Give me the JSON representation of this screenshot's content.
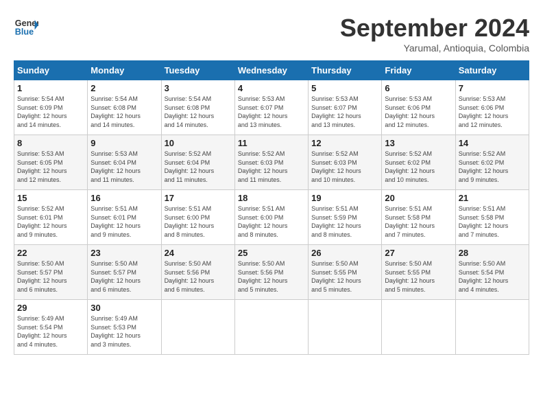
{
  "header": {
    "logo_line1": "General",
    "logo_line2": "Blue",
    "month": "September 2024",
    "location": "Yarumal, Antioquia, Colombia"
  },
  "columns": [
    "Sunday",
    "Monday",
    "Tuesday",
    "Wednesday",
    "Thursday",
    "Friday",
    "Saturday"
  ],
  "weeks": [
    [
      {
        "day": "1",
        "info": "Sunrise: 5:54 AM\nSunset: 6:09 PM\nDaylight: 12 hours\nand 14 minutes."
      },
      {
        "day": "2",
        "info": "Sunrise: 5:54 AM\nSunset: 6:08 PM\nDaylight: 12 hours\nand 14 minutes."
      },
      {
        "day": "3",
        "info": "Sunrise: 5:54 AM\nSunset: 6:08 PM\nDaylight: 12 hours\nand 14 minutes."
      },
      {
        "day": "4",
        "info": "Sunrise: 5:53 AM\nSunset: 6:07 PM\nDaylight: 12 hours\nand 13 minutes."
      },
      {
        "day": "5",
        "info": "Sunrise: 5:53 AM\nSunset: 6:07 PM\nDaylight: 12 hours\nand 13 minutes."
      },
      {
        "day": "6",
        "info": "Sunrise: 5:53 AM\nSunset: 6:06 PM\nDaylight: 12 hours\nand 12 minutes."
      },
      {
        "day": "7",
        "info": "Sunrise: 5:53 AM\nSunset: 6:06 PM\nDaylight: 12 hours\nand 12 minutes."
      }
    ],
    [
      {
        "day": "8",
        "info": "Sunrise: 5:53 AM\nSunset: 6:05 PM\nDaylight: 12 hours\nand 12 minutes."
      },
      {
        "day": "9",
        "info": "Sunrise: 5:53 AM\nSunset: 6:04 PM\nDaylight: 12 hours\nand 11 minutes."
      },
      {
        "day": "10",
        "info": "Sunrise: 5:52 AM\nSunset: 6:04 PM\nDaylight: 12 hours\nand 11 minutes."
      },
      {
        "day": "11",
        "info": "Sunrise: 5:52 AM\nSunset: 6:03 PM\nDaylight: 12 hours\nand 11 minutes."
      },
      {
        "day": "12",
        "info": "Sunrise: 5:52 AM\nSunset: 6:03 PM\nDaylight: 12 hours\nand 10 minutes."
      },
      {
        "day": "13",
        "info": "Sunrise: 5:52 AM\nSunset: 6:02 PM\nDaylight: 12 hours\nand 10 minutes."
      },
      {
        "day": "14",
        "info": "Sunrise: 5:52 AM\nSunset: 6:02 PM\nDaylight: 12 hours\nand 9 minutes."
      }
    ],
    [
      {
        "day": "15",
        "info": "Sunrise: 5:52 AM\nSunset: 6:01 PM\nDaylight: 12 hours\nand 9 minutes."
      },
      {
        "day": "16",
        "info": "Sunrise: 5:51 AM\nSunset: 6:01 PM\nDaylight: 12 hours\nand 9 minutes."
      },
      {
        "day": "17",
        "info": "Sunrise: 5:51 AM\nSunset: 6:00 PM\nDaylight: 12 hours\nand 8 minutes."
      },
      {
        "day": "18",
        "info": "Sunrise: 5:51 AM\nSunset: 6:00 PM\nDaylight: 12 hours\nand 8 minutes."
      },
      {
        "day": "19",
        "info": "Sunrise: 5:51 AM\nSunset: 5:59 PM\nDaylight: 12 hours\nand 8 minutes."
      },
      {
        "day": "20",
        "info": "Sunrise: 5:51 AM\nSunset: 5:58 PM\nDaylight: 12 hours\nand 7 minutes."
      },
      {
        "day": "21",
        "info": "Sunrise: 5:51 AM\nSunset: 5:58 PM\nDaylight: 12 hours\nand 7 minutes."
      }
    ],
    [
      {
        "day": "22",
        "info": "Sunrise: 5:50 AM\nSunset: 5:57 PM\nDaylight: 12 hours\nand 6 minutes."
      },
      {
        "day": "23",
        "info": "Sunrise: 5:50 AM\nSunset: 5:57 PM\nDaylight: 12 hours\nand 6 minutes."
      },
      {
        "day": "24",
        "info": "Sunrise: 5:50 AM\nSunset: 5:56 PM\nDaylight: 12 hours\nand 6 minutes."
      },
      {
        "day": "25",
        "info": "Sunrise: 5:50 AM\nSunset: 5:56 PM\nDaylight: 12 hours\nand 5 minutes."
      },
      {
        "day": "26",
        "info": "Sunrise: 5:50 AM\nSunset: 5:55 PM\nDaylight: 12 hours\nand 5 minutes."
      },
      {
        "day": "27",
        "info": "Sunrise: 5:50 AM\nSunset: 5:55 PM\nDaylight: 12 hours\nand 5 minutes."
      },
      {
        "day": "28",
        "info": "Sunrise: 5:50 AM\nSunset: 5:54 PM\nDaylight: 12 hours\nand 4 minutes."
      }
    ],
    [
      {
        "day": "29",
        "info": "Sunrise: 5:49 AM\nSunset: 5:54 PM\nDaylight: 12 hours\nand 4 minutes."
      },
      {
        "day": "30",
        "info": "Sunrise: 5:49 AM\nSunset: 5:53 PM\nDaylight: 12 hours\nand 3 minutes."
      },
      {
        "day": "",
        "info": ""
      },
      {
        "day": "",
        "info": ""
      },
      {
        "day": "",
        "info": ""
      },
      {
        "day": "",
        "info": ""
      },
      {
        "day": "",
        "info": ""
      }
    ]
  ]
}
